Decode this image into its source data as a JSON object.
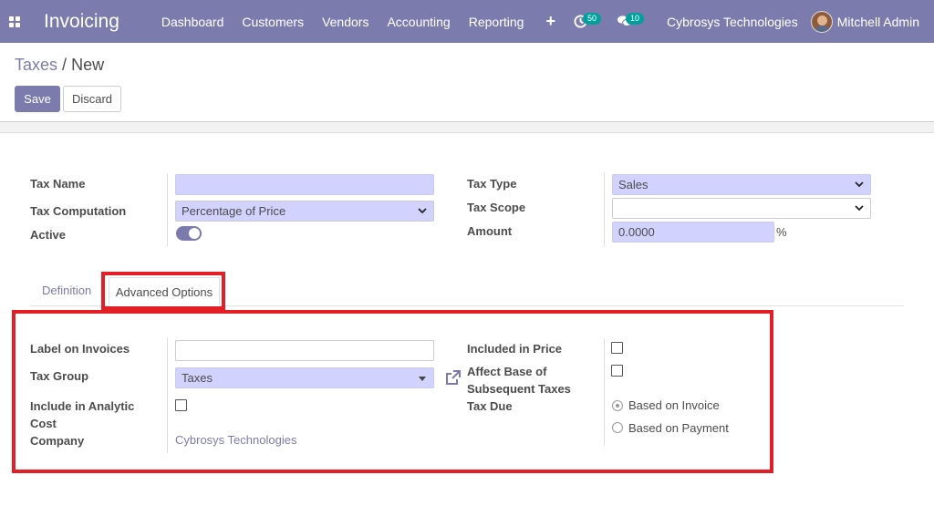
{
  "navbar": {
    "app_name": "Invoicing",
    "menu": [
      "Dashboard",
      "Customers",
      "Vendors",
      "Accounting",
      "Reporting"
    ],
    "activity_count": "50",
    "message_count": "10",
    "company": "Cybrosys Technologies",
    "user": "Mitchell Admin"
  },
  "breadcrumb": {
    "parent": "Taxes",
    "separator": "/",
    "current": "New"
  },
  "buttons": {
    "save": "Save",
    "discard": "Discard"
  },
  "form": {
    "tax_name_label": "Tax Name",
    "tax_name_value": "",
    "tax_computation_label": "Tax Computation",
    "tax_computation_value": "Percentage of Price",
    "active_label": "Active",
    "active": true,
    "tax_type_label": "Tax Type",
    "tax_type_value": "Sales",
    "tax_scope_label": "Tax Scope",
    "tax_scope_value": "",
    "amount_label": "Amount",
    "amount_value": "0.0000",
    "amount_unit": "%"
  },
  "tabs": {
    "definition": "Definition",
    "advanced": "Advanced Options",
    "active_tab": "Advanced Options"
  },
  "advanced": {
    "label_on_invoices": "Label on Invoices",
    "label_on_invoices_value": "",
    "tax_group_label": "Tax Group",
    "tax_group_value": "Taxes",
    "include_analytic_l1": "Include in Analytic",
    "include_analytic_l2": "Cost",
    "company_label": "Company",
    "company_value": "Cybrosys Technologies",
    "included_in_price": "Included in Price",
    "affect_base_l1": "Affect Base of",
    "affect_base_l2": "Subsequent Taxes",
    "tax_due_label": "Tax Due",
    "tax_due_options": [
      "Based on Invoice",
      "Based on Payment"
    ],
    "tax_due_selected": "Based on Invoice"
  },
  "colors": {
    "brand": "#7c7bad",
    "highlight": "#e21f27",
    "required_input": "#d2d2ff"
  }
}
